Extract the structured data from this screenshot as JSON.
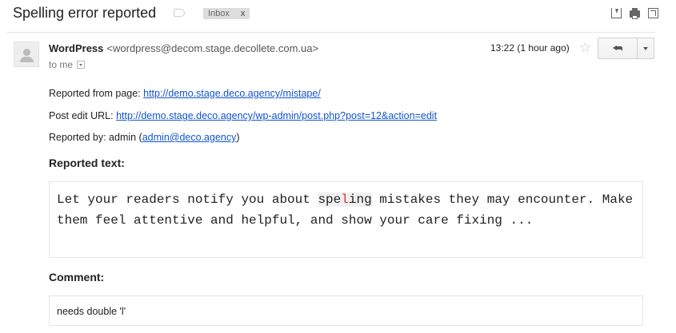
{
  "email": {
    "subject": "Spelling error reported",
    "label_chip": "Inbox",
    "label_chip_close": "x",
    "sender_name": "WordPress",
    "sender_email": "<wordpress@decom.stage.decollete.com.ua>",
    "recipient": "to me",
    "timestamp": "13:22 (1 hour ago)"
  },
  "body": {
    "reported_from_label": "Reported from page: ",
    "reported_from_url": "http://demo.stage.deco.agency/mistape/",
    "post_edit_label": "Post edit URL: ",
    "post_edit_url": "http://demo.stage.deco.agency/wp-admin/post.php?post=12&action=edit",
    "reported_by_label": "Reported by: admin (",
    "reported_by_email": "admin@deco.agency",
    "reported_by_close": ")",
    "reported_text_heading": "Reported text:",
    "quote_before": "Let your readers notify you about ",
    "quote_word_start": "spe",
    "quote_word_error": "l",
    "quote_word_end": "ing",
    "quote_after": " mistakes they may encounter. Make them feel attentive and helpful, and show your care fixing ...",
    "comment_heading": "Comment:",
    "comment_text": "needs double 'l'"
  },
  "icons": {
    "label": "label-tag-icon",
    "download": "download-icon",
    "print": "print-icon",
    "new_window": "new-window-icon",
    "star": "star-icon",
    "reply": "reply-icon",
    "more": "caret-down-icon",
    "avatar": "avatar-icon"
  }
}
